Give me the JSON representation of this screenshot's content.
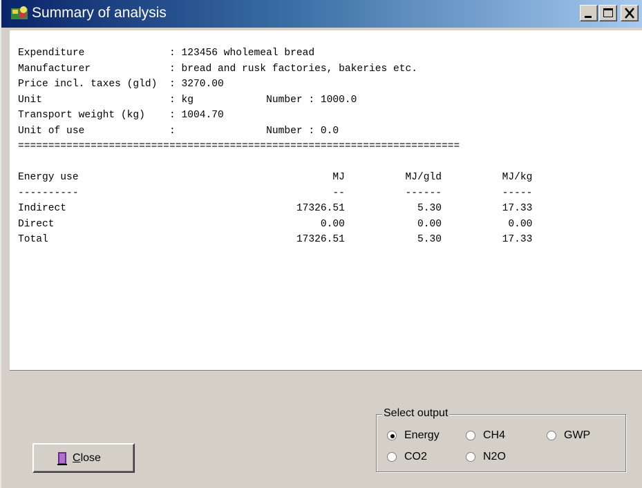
{
  "window": {
    "title": "Summary of analysis",
    "controls": {
      "minimize": "_",
      "maximize": "□",
      "close": "X"
    }
  },
  "report": {
    "lines": [
      "Expenditure              : 123456 wholemeal bread",
      "Manufacturer             : bread and rusk factories, bakeries etc.",
      "Price incl. taxes (gld)  : 3270.00",
      "Unit                     : kg            Number : 1000.0",
      "Transport weight (kg)    : 1004.70",
      "Unit of use              :               Number : 0.0",
      "=========================================================================",
      "",
      "Energy use                                          MJ          MJ/gld          MJ/kg",
      "----------                                          --          ------          -----",
      "Indirect                                      17326.51            5.30          17.33",
      "Direct                                            0.00            0.00           0.00",
      "Total                                         17326.51            5.30          17.33"
    ]
  },
  "buttons": {
    "close_label_mnemonic": "C",
    "close_label_rest": "lose"
  },
  "output_select": {
    "legend": "Select output",
    "options": [
      {
        "label": "Energy",
        "selected": true
      },
      {
        "label": "CH4",
        "selected": false
      },
      {
        "label": "GWP",
        "selected": false
      },
      {
        "label": "CO2",
        "selected": false
      },
      {
        "label": "N2O",
        "selected": false
      }
    ]
  }
}
